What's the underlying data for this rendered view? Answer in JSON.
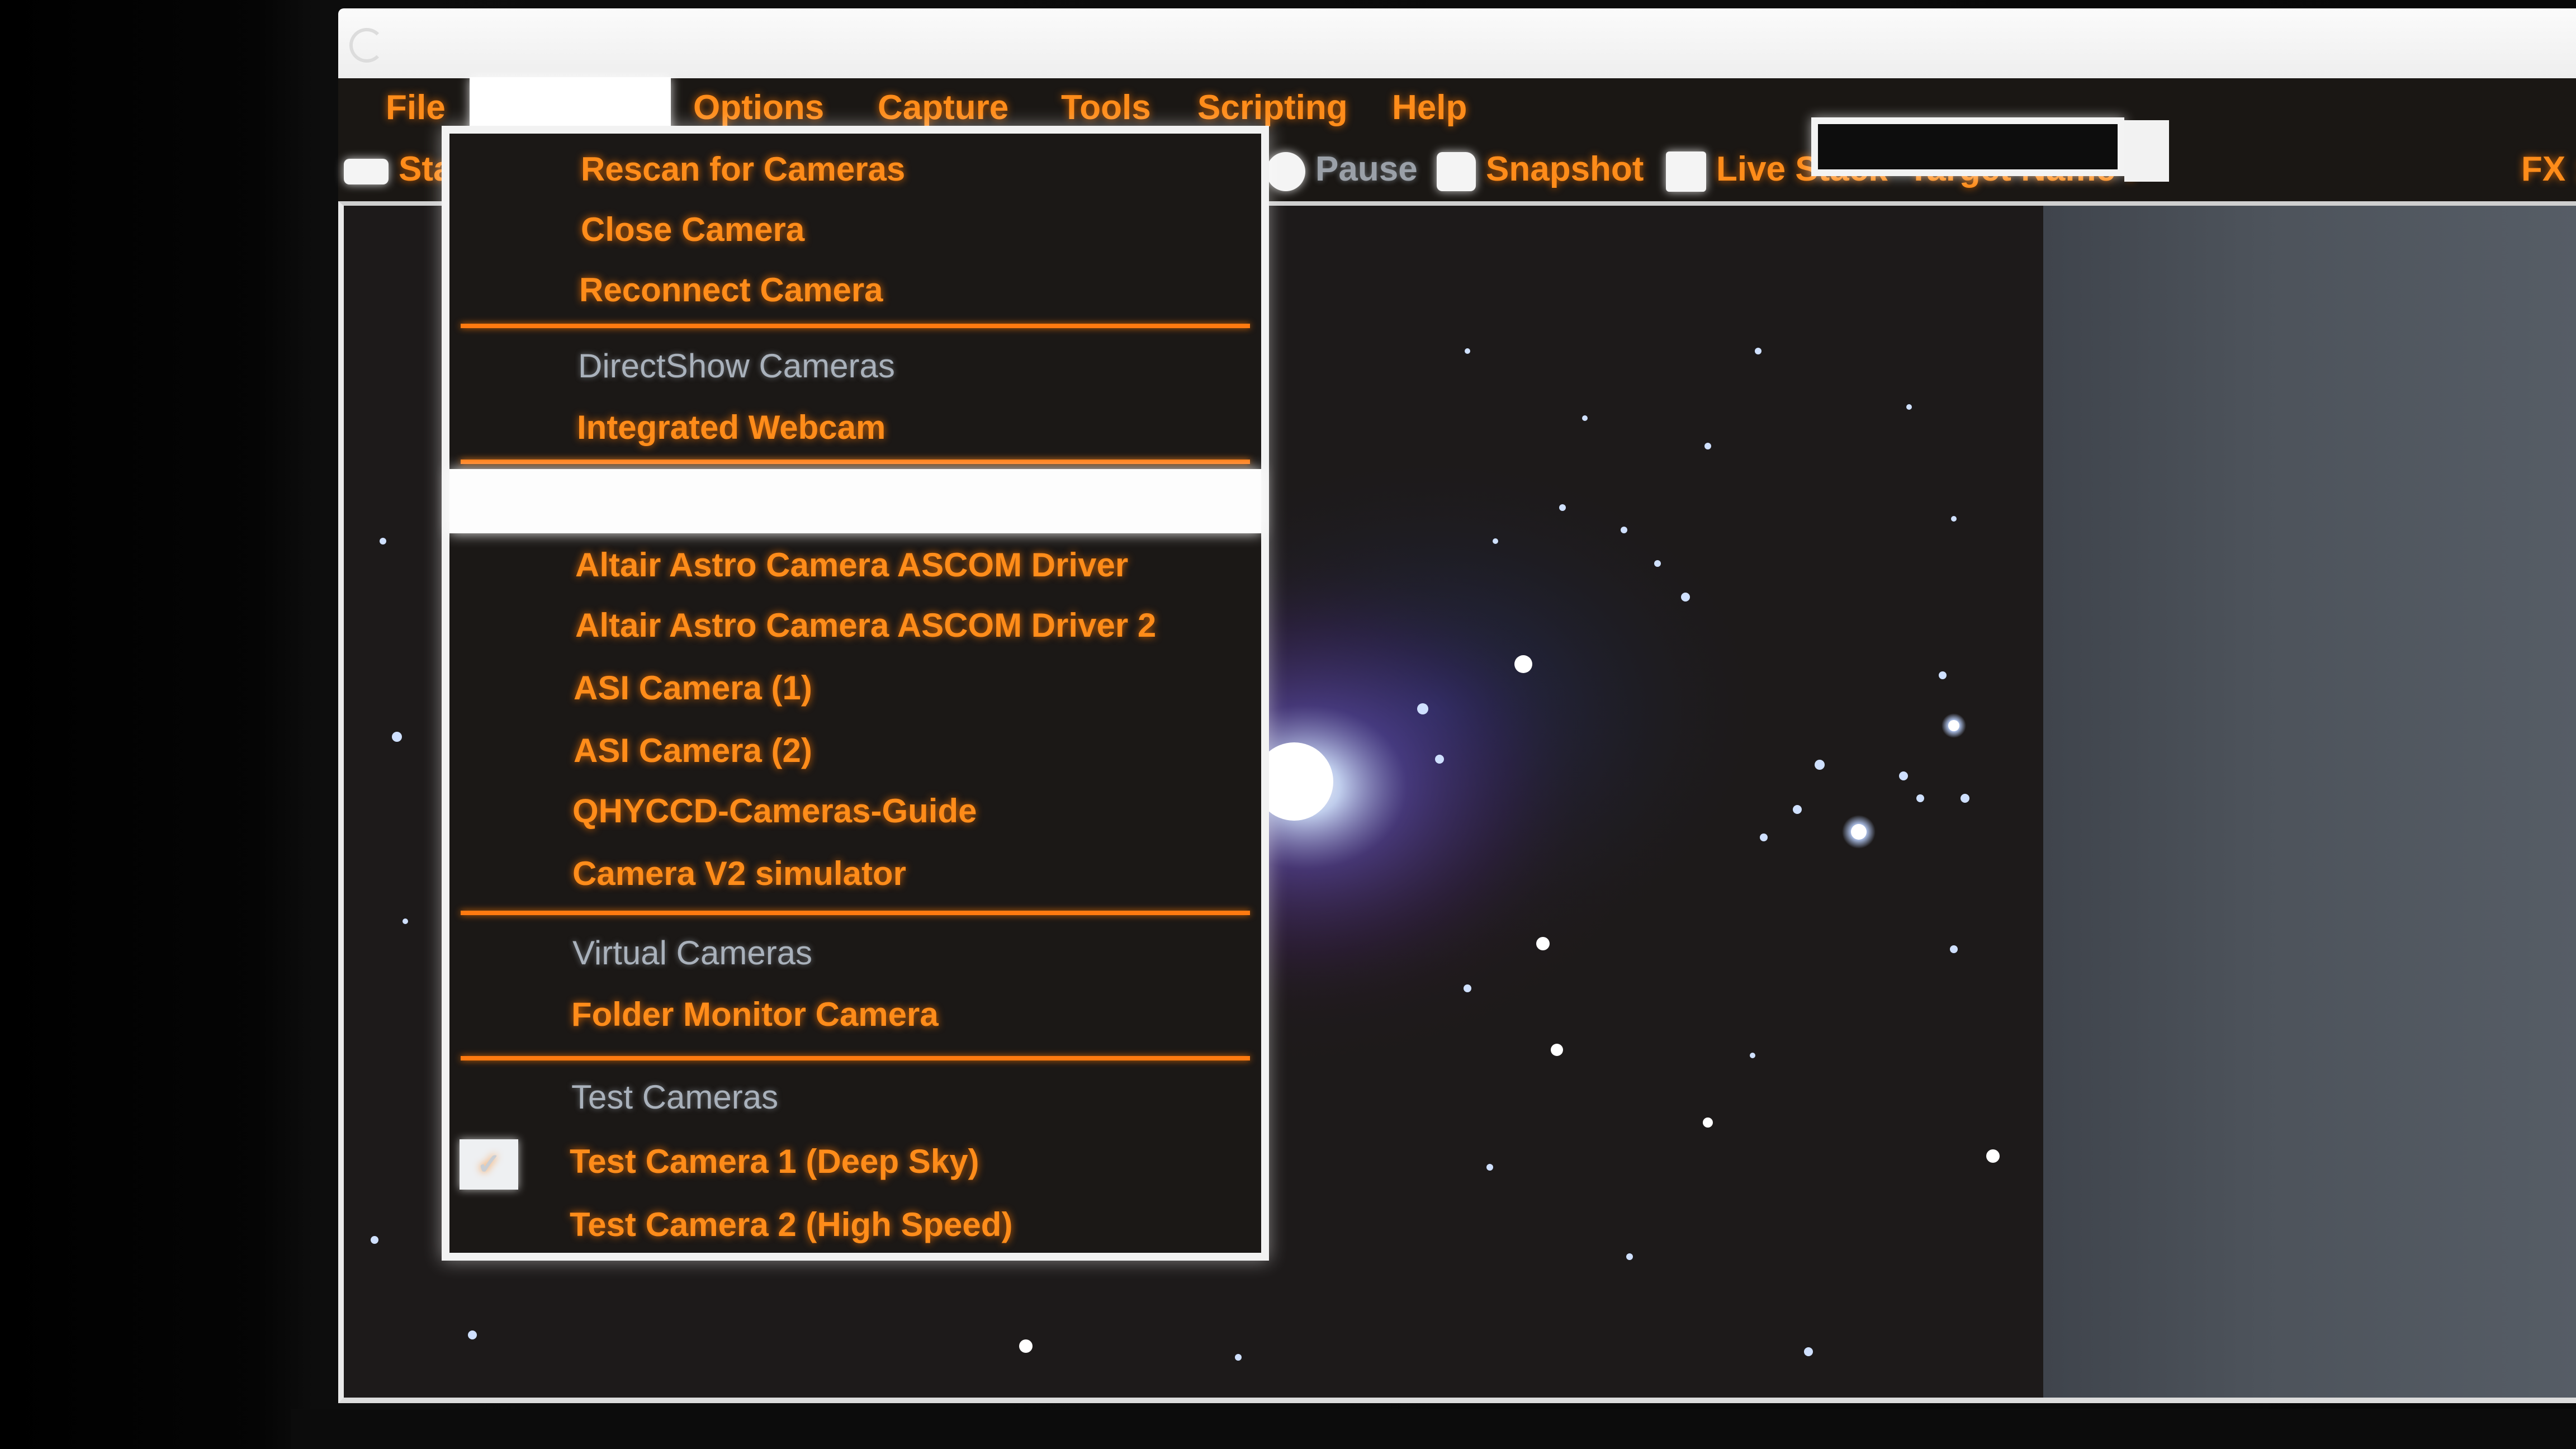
{
  "menubar": {
    "file": "File",
    "options": "Options",
    "capture": "Capture",
    "tools": "Tools",
    "scripting": "Scripting",
    "help": "Help"
  },
  "toolbar": {
    "start_label": "Star",
    "pause_label": "Pause",
    "snapshot_label": "Snapshot",
    "live_stack_label": "Live Stack",
    "target_name_label": "Target Name :",
    "target_name_value": "",
    "fx_label": "FX :"
  },
  "camera_menu": {
    "rescan": "Rescan for Cameras",
    "close": "Close Camera",
    "reconnect": "Reconnect Camera",
    "directshow_group": "DirectShow Cameras",
    "integrated_webcam": "Integrated Webcam",
    "ascom_items": [
      "Altair Astro Camera ASCOM Driver",
      "Altair Astro Camera ASCOM Driver 2",
      "ASI Camera (1)",
      "ASI Camera (2)",
      "QHYCCD-Cameras-Guide",
      "Camera V2 simulator"
    ],
    "virtual_group": "Virtual Cameras",
    "folder_monitor": "Folder Monitor Camera",
    "test_group": "Test Cameras",
    "test_camera_1": "Test Camera 1 (Deep Sky)",
    "test_camera_2": "Test Camera 2 (High Speed)"
  },
  "colors": {
    "menu_text": "#ff8c1a",
    "group_text": "#a9b1bb",
    "separator": "#ff7a10",
    "menu_background": "#1b1816",
    "side_panel": "#4d535b"
  },
  "icons": {
    "start": "camera-icon",
    "pause": "pause-icon",
    "snapshot": "snapshot-icon",
    "live_stack": "live-stack-icon",
    "app": "app-icon",
    "checkmark": "checkmark-icon"
  }
}
